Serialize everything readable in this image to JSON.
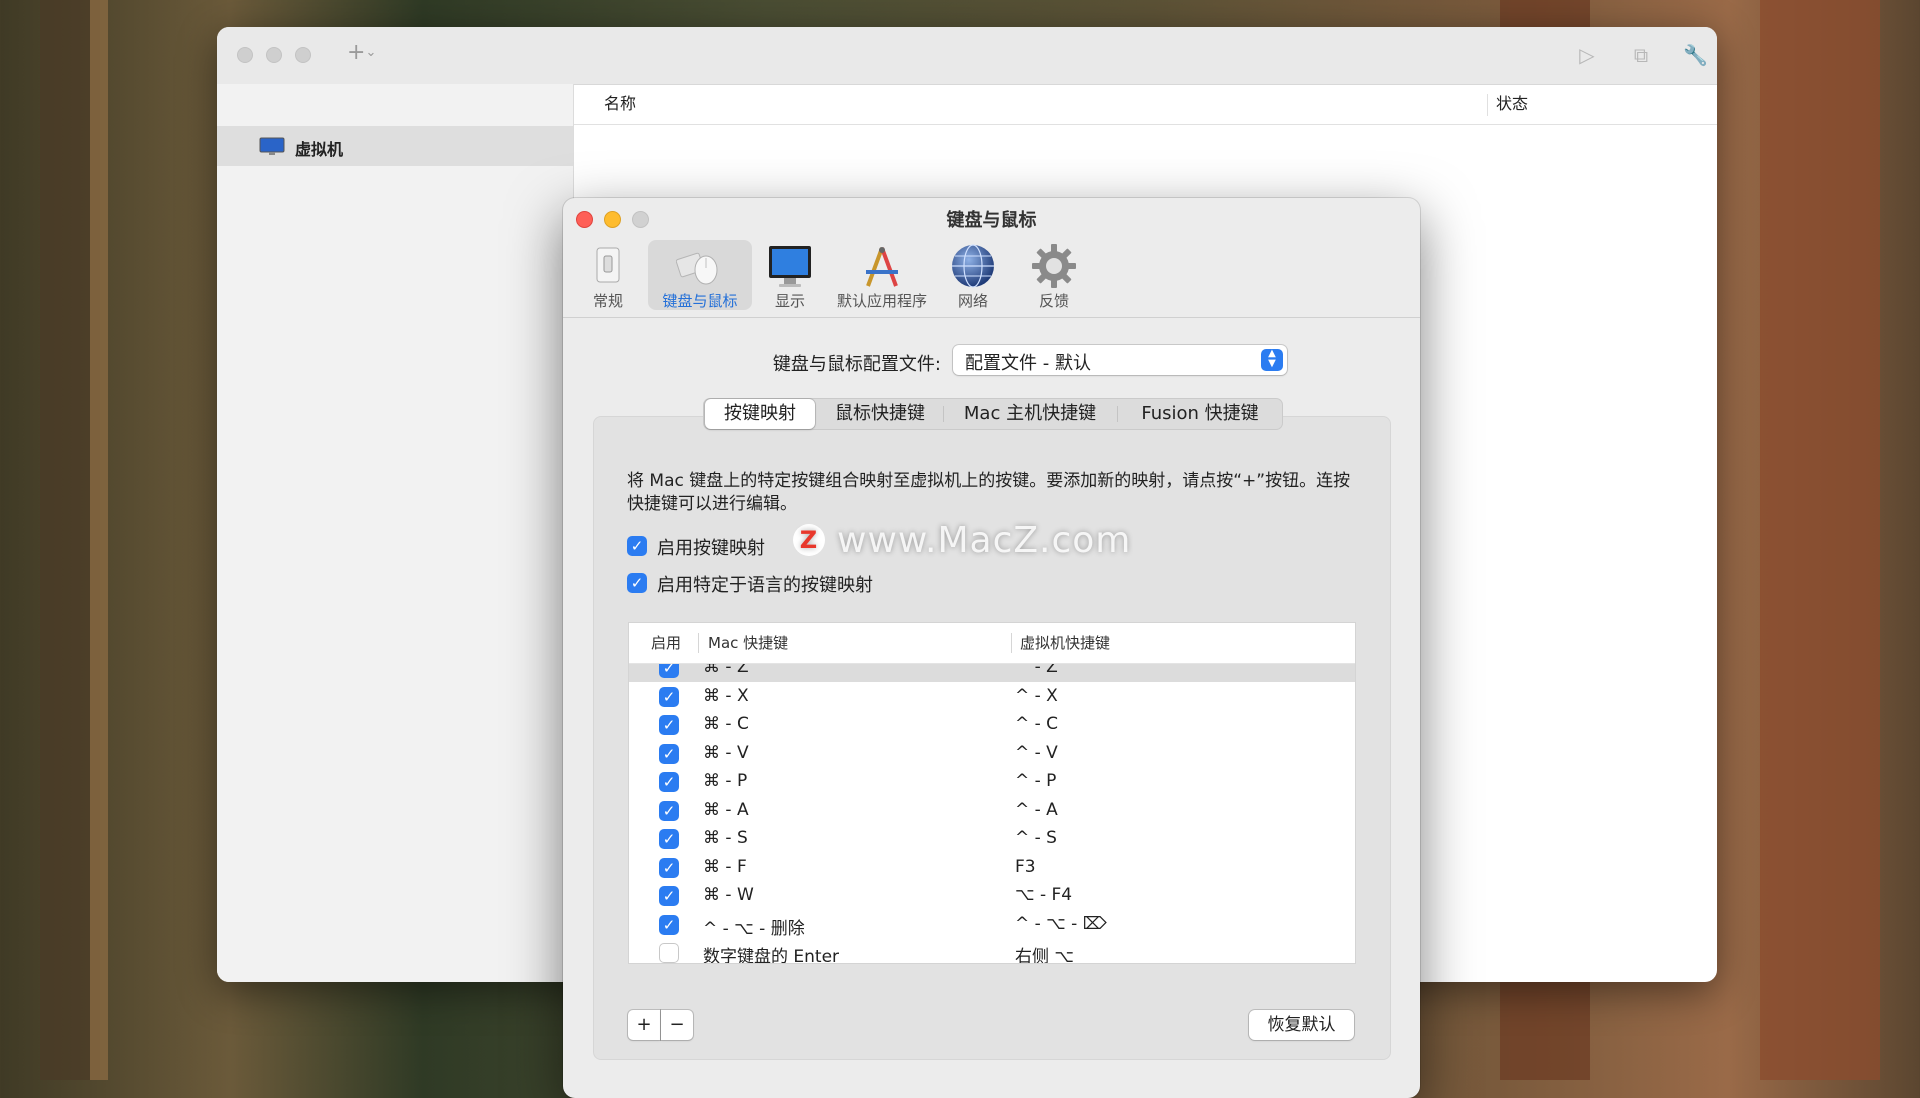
{
  "library_window": {
    "sidebar": {
      "items": [
        {
          "label": "虚拟机",
          "icon": "monitor-icon"
        }
      ]
    },
    "columns": {
      "name": "名称",
      "status": "状态"
    },
    "toolbar_icons": [
      "plus-icon",
      "play-icon",
      "snapshot-icon",
      "wrench-icon"
    ]
  },
  "dialog": {
    "title": "键盘与鼠标",
    "toolbar": [
      {
        "label": "常规",
        "icon": "switch-icon",
        "active": false
      },
      {
        "label": "键盘与鼠标",
        "icon": "mouse-icon",
        "active": true
      },
      {
        "label": "显示",
        "icon": "display-icon",
        "active": false
      },
      {
        "label": "默认应用程序",
        "icon": "applications-icon",
        "active": false
      },
      {
        "label": "网络",
        "icon": "globe-icon",
        "active": false
      },
      {
        "label": "反馈",
        "icon": "gear-icon",
        "active": false
      }
    ],
    "profile_label": "键盘与鼠标配置文件:",
    "profile_value": "配置文件 - 默认",
    "tabs": [
      "按键映射",
      "鼠标快捷键",
      "Mac 主机快捷键",
      "Fusion 快捷键"
    ],
    "active_tab": 0,
    "description": "将 Mac 键盘上的特定按键组合映射至虚拟机上的按键。要添加新的映射，请点按“+”按钮。连按快捷键可以进行编辑。",
    "enable_mapping": {
      "label": "启用按键映射",
      "checked": true
    },
    "enable_language": {
      "label": "启用特定于语言的按键映射",
      "checked": true
    },
    "table_headers": {
      "enabled": "启用",
      "mac": "Mac 快捷键",
      "vm": "虚拟机快捷键"
    },
    "rows": [
      {
        "enabled": true,
        "mac": "⌘ - Z",
        "vm": "^ - Z",
        "selected": true
      },
      {
        "enabled": true,
        "mac": "⌘ - X",
        "vm": "^ - X"
      },
      {
        "enabled": true,
        "mac": "⌘ - C",
        "vm": "^ - C"
      },
      {
        "enabled": true,
        "mac": "⌘ - V",
        "vm": "^ - V"
      },
      {
        "enabled": true,
        "mac": "⌘ - P",
        "vm": "^ - P"
      },
      {
        "enabled": true,
        "mac": "⌘ - A",
        "vm": "^ - A"
      },
      {
        "enabled": true,
        "mac": "⌘ - S",
        "vm": "^ - S"
      },
      {
        "enabled": true,
        "mac": "⌘ - F",
        "vm": "F3"
      },
      {
        "enabled": true,
        "mac": "⌘ - W",
        "vm": "⌥ - F4"
      },
      {
        "enabled": true,
        "mac": "^ - ⌥ - 删除",
        "vm": "^ - ⌥ - ⌦"
      },
      {
        "enabled": false,
        "mac": "数字键盘的 Enter",
        "vm": "右侧 ⌥"
      }
    ],
    "add_button": "+",
    "remove_button": "−",
    "restore_button": "恢复默认"
  },
  "watermark": {
    "logo": "Z",
    "text": "www.MacZ.com"
  },
  "colors": {
    "accent": "#2b7cf1",
    "close": "#fe5f57",
    "minimize": "#febc2e"
  }
}
